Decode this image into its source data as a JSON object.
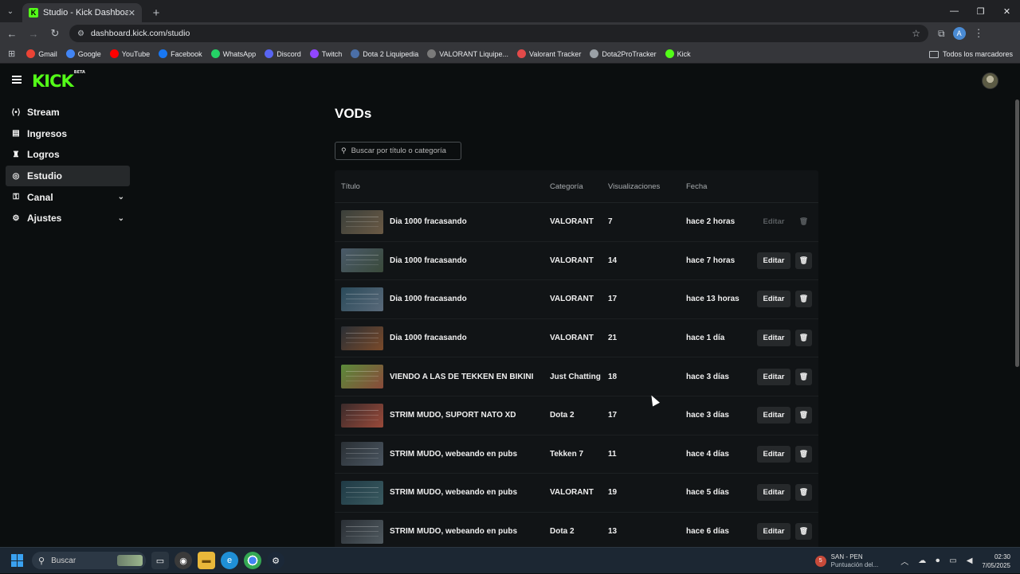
{
  "browser": {
    "tab_title": "Studio - Kick Dashboard",
    "url": "dashboard.kick.com/studio",
    "bookmarks": [
      {
        "label": "Gmail",
        "color": "#ea4335",
        "icon": "gmail-icon"
      },
      {
        "label": "Google",
        "color": "#4285f4",
        "icon": "google-icon"
      },
      {
        "label": "YouTube",
        "color": "#ff0000",
        "icon": "youtube-icon"
      },
      {
        "label": "Facebook",
        "color": "#1877f2",
        "icon": "facebook-icon"
      },
      {
        "label": "WhatsApp",
        "color": "#25d366",
        "icon": "whatsapp-icon"
      },
      {
        "label": "Discord",
        "color": "#5865f2",
        "icon": "discord-icon"
      },
      {
        "label": "Twitch",
        "color": "#9146ff",
        "icon": "twitch-icon"
      },
      {
        "label": "Dota 2 Liquipedia",
        "color": "#4b6fa8",
        "icon": "liquipedia-icon"
      },
      {
        "label": "VALORANT Liquipe...",
        "color": "#7a7a7a",
        "icon": "liquipedia-valorant-icon"
      },
      {
        "label": "Valorant Tracker",
        "color": "#e24a4a",
        "icon": "valorant-tracker-icon"
      },
      {
        "label": "Dota2ProTracker",
        "color": "#9aa0a6",
        "icon": "dota2protracker-icon"
      },
      {
        "label": "Kick",
        "color": "#53fc18",
        "icon": "kick-icon"
      }
    ],
    "all_bookmarks_label": "Todos los marcadores",
    "profile_initial": "A"
  },
  "kick": {
    "logo": "KICK",
    "logo_badge": "BETA",
    "accent": "#53fc18"
  },
  "sidebar": {
    "items": [
      {
        "label": "Stream",
        "icon": "broadcast-icon",
        "active": false,
        "expandable": false
      },
      {
        "label": "Ingresos",
        "icon": "revenue-icon",
        "active": false,
        "expandable": false
      },
      {
        "label": "Logros",
        "icon": "trophy-icon",
        "active": false,
        "expandable": false
      },
      {
        "label": "Estudio",
        "icon": "studio-icon",
        "active": true,
        "expandable": false
      },
      {
        "label": "Canal",
        "icon": "channel-icon",
        "active": false,
        "expandable": true
      },
      {
        "label": "Ajustes",
        "icon": "gear-icon",
        "active": false,
        "expandable": true
      }
    ]
  },
  "main": {
    "title": "VODs",
    "search_placeholder": "Buscar por título o categoría",
    "columns": [
      "Título",
      "Categoría",
      "Visualizaciones",
      "Fecha"
    ],
    "edit_label": "Editar",
    "rows": [
      {
        "title": "Dia 1000 fracasando",
        "category": "VALORANT",
        "views": "7",
        "date": "hace 2 horas",
        "disabled": true,
        "thumb": [
          "#3a3f3a",
          "#6b5a45"
        ]
      },
      {
        "title": "Dia 1000 fracasando",
        "category": "VALORANT",
        "views": "14",
        "date": "hace 7 horas",
        "disabled": false,
        "thumb": [
          "#4a5a6a",
          "#3a4a3a"
        ]
      },
      {
        "title": "Dia 1000 fracasando",
        "category": "VALORANT",
        "views": "17",
        "date": "hace 13 horas",
        "disabled": false,
        "thumb": [
          "#2a4a5a",
          "#5a6a7a"
        ]
      },
      {
        "title": "Dia 1000 fracasando",
        "category": "VALORANT",
        "views": "21",
        "date": "hace 1 día",
        "disabled": false,
        "thumb": [
          "#2a2f35",
          "#7a4a2a"
        ]
      },
      {
        "title": "VIENDO A LAS DE TEKKEN EN BIKINI",
        "category": "Just Chatting",
        "views": "18",
        "date": "hace 3 días",
        "disabled": false,
        "thumb": [
          "#5a8a3a",
          "#8a4a3a"
        ]
      },
      {
        "title": "STRIM MUDO, SUPORT NATO XD",
        "category": "Dota 2",
        "views": "17",
        "date": "hace 3 días",
        "disabled": false,
        "thumb": [
          "#3a2a2a",
          "#9a4a3a"
        ]
      },
      {
        "title": "STRIM MUDO, webeando en pubs",
        "category": "Tekken 7",
        "views": "11",
        "date": "hace 4 días",
        "disabled": false,
        "thumb": [
          "#2a3035",
          "#4a5560"
        ]
      },
      {
        "title": "STRIM MUDO, webeando en pubs",
        "category": "VALORANT",
        "views": "19",
        "date": "hace 5 días",
        "disabled": false,
        "thumb": [
          "#1f3a45",
          "#3a5a60"
        ]
      },
      {
        "title": "STRIM MUDO, webeando en pubs",
        "category": "Dota 2",
        "views": "13",
        "date": "hace 6 días",
        "disabled": false,
        "thumb": [
          "#2a2f35",
          "#505a60"
        ]
      }
    ]
  },
  "taskbar": {
    "search_placeholder": "Buscar",
    "weather_badge": "5",
    "weather_title": "SAN - PEN",
    "weather_sub": "Puntuación del...",
    "time": "02:30",
    "date": "7/05/2025"
  }
}
